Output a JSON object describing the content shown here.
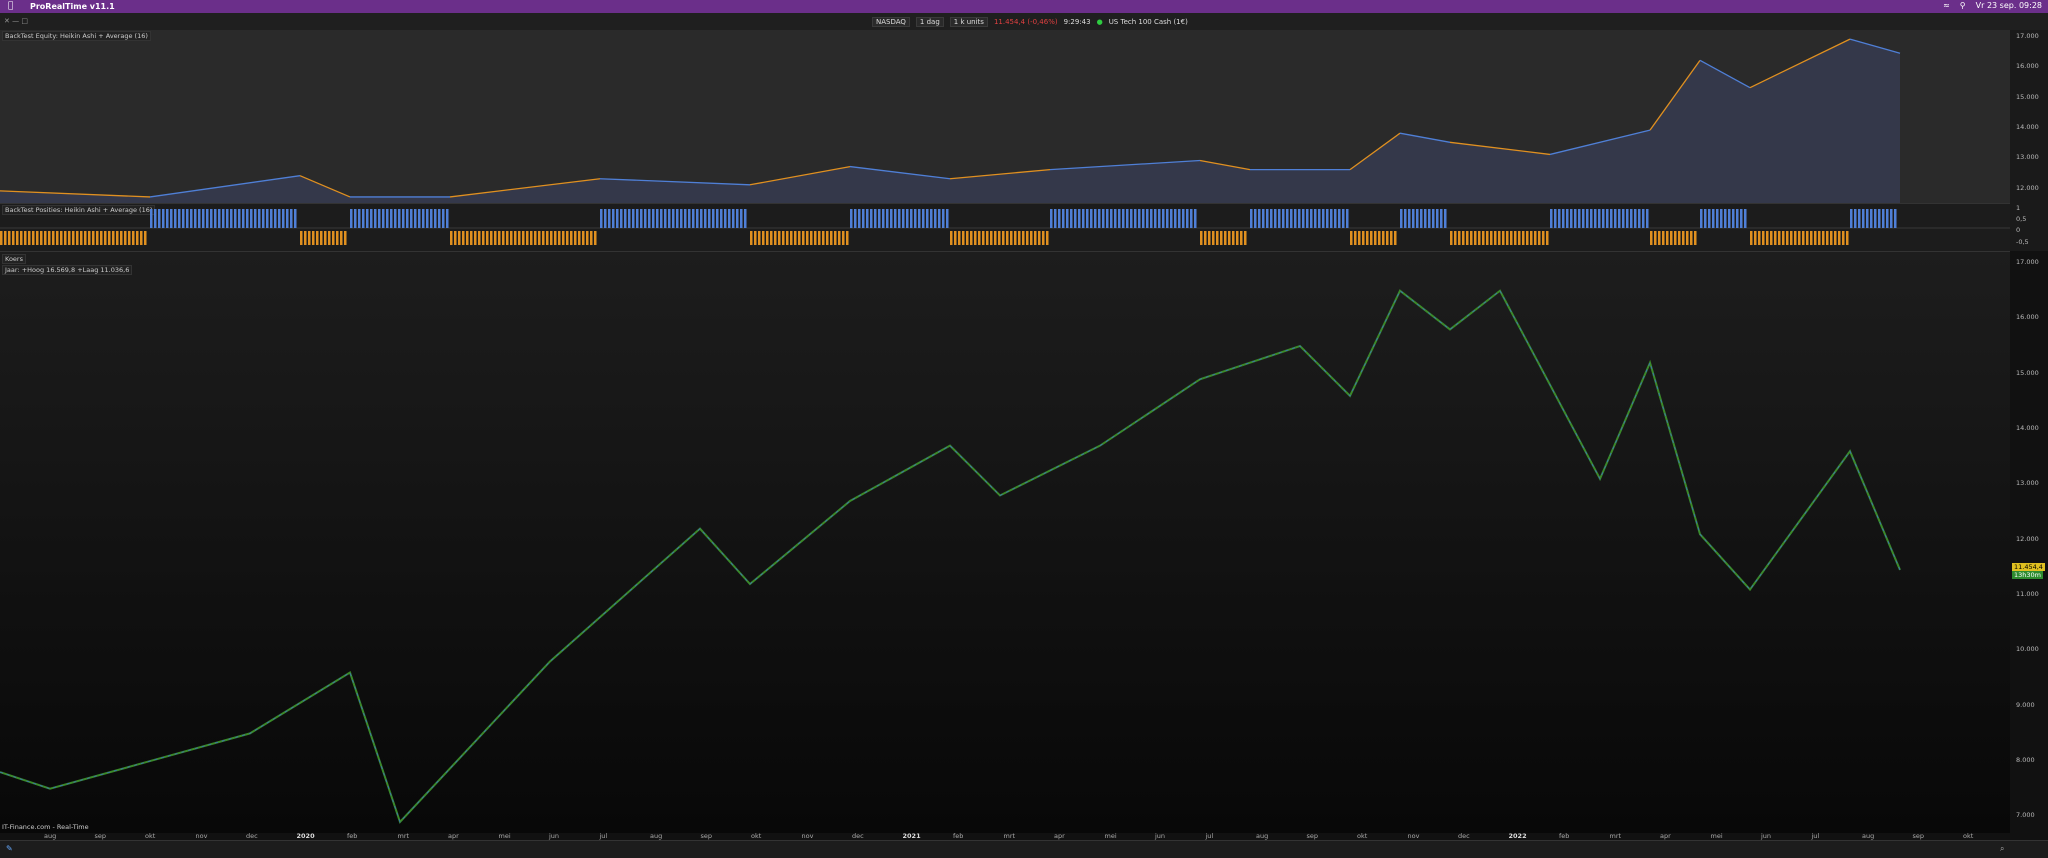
{
  "menubar": {
    "app_name": "ProRealTime v11.1",
    "datetime": "Vr 23 sep. 09:28"
  },
  "toolbar": {
    "market": "NASDAQ",
    "period": "1 dag",
    "units": "1 k units",
    "price_change": "11.454,4 (-0,46%)",
    "time": "9:29:43",
    "instrument": "US Tech 100 Cash (1€)"
  },
  "equity_panel": {
    "label": "BackTest Equity: Heikin Ashi + Average (16)",
    "y_ticks": [
      "17.000",
      "16.000",
      "15.000",
      "14.000",
      "13.000",
      "12.000"
    ],
    "last_value": "16.433"
  },
  "positions_panel": {
    "label": "BackTest Posities: Heikin Ashi + Average (16)",
    "y_ticks": [
      "1",
      "0,5",
      "0",
      "-0,5"
    ]
  },
  "price_panel": {
    "label": "Koers",
    "sublabel": "Jaar: +Hoog 16.569,8 +Laag 11.036,6",
    "y_ticks": [
      "17.000",
      "16.000",
      "15.000",
      "14.000",
      "13.000",
      "12.000",
      "11.000",
      "10.000",
      "9.000",
      "8.000",
      "7.000"
    ],
    "last_price": "11.454,4",
    "countdown": "13h30m"
  },
  "x_axis": [
    "aug",
    "sep",
    "okt",
    "nov",
    "dec",
    "2020",
    "feb",
    "mrt",
    "apr",
    "mei",
    "jun",
    "jul",
    "aug",
    "sep",
    "okt",
    "nov",
    "dec",
    "2021",
    "feb",
    "mrt",
    "apr",
    "mei",
    "jun",
    "jul",
    "aug",
    "sep",
    "okt",
    "nov",
    "dec",
    "2022",
    "feb",
    "mrt",
    "apr",
    "mei",
    "jun",
    "jul",
    "aug",
    "sep",
    "okt"
  ],
  "credit": "IT-Finance.com - Real-Time",
  "colors": {
    "long": "#4f7fd6",
    "short": "#e09020",
    "menubar": "#6b2f8a"
  },
  "chart_data": [
    {
      "type": "line",
      "title": "BackTest Equity: Heikin Ashi + Average (16)",
      "ylim": [
        11500,
        17200
      ],
      "x": [
        "2019-07",
        "2019-10",
        "2020-01",
        "2020-02",
        "2020-04",
        "2020-07",
        "2020-10",
        "2020-12",
        "2021-02",
        "2021-04",
        "2021-07",
        "2021-08",
        "2021-10",
        "2021-11",
        "2021-12",
        "2022-02",
        "2022-04",
        "2022-05",
        "2022-06",
        "2022-08",
        "2022-09"
      ],
      "values": [
        11900,
        11700,
        12400,
        11700,
        11700,
        12300,
        12100,
        12700,
        12300,
        12600,
        12900,
        12600,
        12600,
        13800,
        13500,
        13100,
        13900,
        16200,
        15300,
        16900,
        16433
      ]
    },
    {
      "type": "line",
      "title": "Koers",
      "ylim": [
        6700,
        17200
      ],
      "x": [
        "2019-07",
        "2019-08",
        "2019-10",
        "2019-12",
        "2020-02",
        "2020-03",
        "2020-06",
        "2020-09",
        "2020-10",
        "2020-12",
        "2021-02",
        "2021-03",
        "2021-05",
        "2021-07",
        "2021-09",
        "2021-10",
        "2021-11",
        "2021-12",
        "2022-01",
        "2022-03",
        "2022-04",
        "2022-05",
        "2022-06",
        "2022-08",
        "2022-09"
      ],
      "values": [
        7800,
        7500,
        8000,
        8500,
        9600,
        6900,
        9800,
        12200,
        11200,
        12700,
        13700,
        12800,
        13700,
        14900,
        15500,
        14600,
        16500,
        15800,
        16500,
        13100,
        15200,
        12100,
        11100,
        13600,
        11454
      ]
    }
  ]
}
